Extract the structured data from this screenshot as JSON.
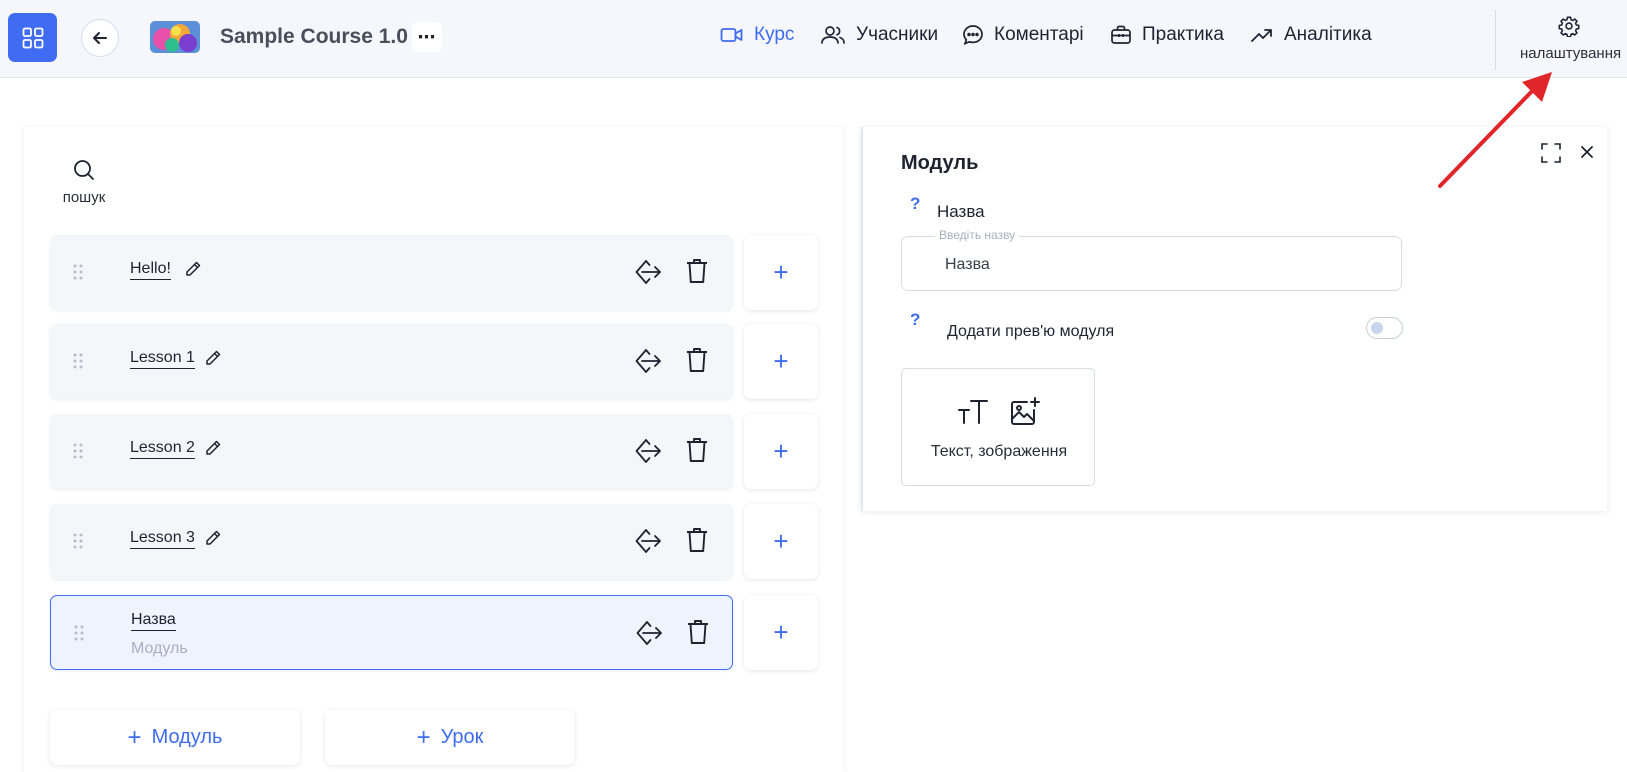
{
  "header": {
    "course_title": "Sample Course 1.0",
    "more_label": "⋯",
    "nav": [
      {
        "label": "Курс",
        "icon": "video-icon",
        "active": true
      },
      {
        "label": "Учасники",
        "icon": "users-icon",
        "active": false
      },
      {
        "label": "Коментарі",
        "icon": "comment-icon",
        "active": false
      },
      {
        "label": "Практика",
        "icon": "briefcase-icon",
        "active": false
      },
      {
        "label": "Аналітика",
        "icon": "trend-icon",
        "active": false
      }
    ],
    "settings_label": "налаштування"
  },
  "left": {
    "search_label": "пошук",
    "items": [
      {
        "title": "Hello!",
        "subtitle": ""
      },
      {
        "title": "Lesson 1",
        "subtitle": ""
      },
      {
        "title": "Lesson 2",
        "subtitle": ""
      },
      {
        "title": "Lesson 3",
        "subtitle": ""
      },
      {
        "title": "Назва",
        "subtitle": "Модуль",
        "selected": true
      }
    ],
    "add_label": "+",
    "add_module_label": "Модуль",
    "add_lesson_label": "Урок",
    "plus": "+"
  },
  "right": {
    "title": "Модуль",
    "help": "?",
    "name_label": "Назва",
    "name_legend": "Введіть назву",
    "name_value": "Назва",
    "preview_label": "Додати прев'ю модуля",
    "preview_enabled": false,
    "content_card_label": "Текст, зображення"
  },
  "colors": {
    "accent": "#3f6cf2",
    "annotation_arrow": "#e0262a"
  }
}
